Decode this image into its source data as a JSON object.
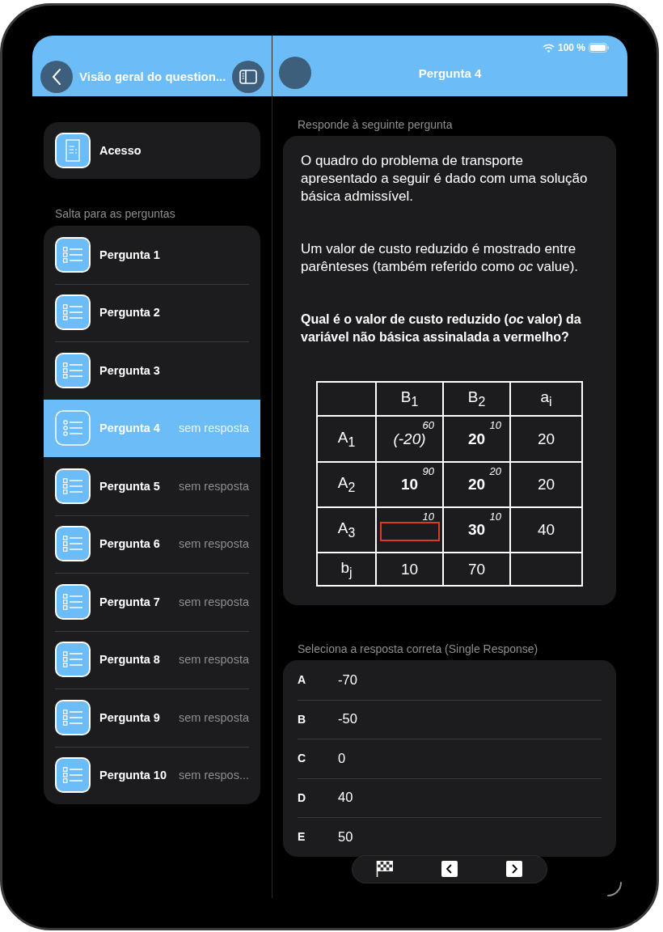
{
  "sidebar": {
    "title": "Visão geral do question...",
    "access_item": {
      "label": "Acesso"
    },
    "section_label": "Salta para as perguntas",
    "items": [
      {
        "label": "Pergunta 1",
        "selected": false
      },
      {
        "label": "Pergunta 2",
        "selected": false
      },
      {
        "label": "Pergunta 3",
        "selected": false
      },
      {
        "label": "Pergunta 4",
        "status": "sem resposta",
        "selected": true
      },
      {
        "label": "Pergunta 5",
        "status": "sem resposta",
        "selected": false
      },
      {
        "label": "Pergunta 6",
        "status": "sem resposta",
        "selected": false
      },
      {
        "label": "Pergunta 7",
        "status": "sem resposta",
        "selected": false
      },
      {
        "label": "Pergunta 8",
        "status": "sem resposta",
        "selected": false
      },
      {
        "label": "Pergunta 9",
        "status": "sem resposta",
        "selected": false
      },
      {
        "label": "Pergunta 10",
        "status": "sem respos...",
        "selected": false
      }
    ]
  },
  "status_bar": {
    "battery": "100 %"
  },
  "detail": {
    "title": "Pergunta 4",
    "question_label": "Responde à seguinte pergunta",
    "paragraphs": [
      {
        "text": "O quadro do problema de transporte apresentado a seguir é dado com uma solução básica admissível.",
        "bold": false
      },
      {
        "text": "Um valor de custo reduzido é mostrado entre parênteses (também referido como *oc* value).",
        "bold": false
      },
      {
        "text": "Qual é o valor de custo reduzido (*oc* valor) da variável não básica assinalada a vermelho?",
        "bold": true
      }
    ],
    "table": {
      "rows": [
        [
          {
            "kind": "empty"
          },
          {
            "kind": "label",
            "value": "B$_{1}$"
          },
          {
            "kind": "label",
            "value": "B$_{2}$"
          },
          {
            "kind": "label",
            "value": "a$_{i}$"
          }
        ],
        [
          {
            "kind": "label",
            "value": "A$_{1}$"
          },
          {
            "kind": "nonbasic",
            "value": "(-20)",
            "cost": "60"
          },
          {
            "kind": "basic",
            "value": "20",
            "cost": "10"
          },
          {
            "kind": "plain",
            "value": "20"
          }
        ],
        [
          {
            "kind": "label",
            "value": "A$_{2}$"
          },
          {
            "kind": "basic",
            "value": "10",
            "cost": "90"
          },
          {
            "kind": "basic",
            "value": "20",
            "cost": "20"
          },
          {
            "kind": "plain",
            "value": "20"
          }
        ],
        [
          {
            "kind": "label",
            "value": "A$_{3}$"
          },
          {
            "kind": "marked",
            "cost": "10"
          },
          {
            "kind": "basic",
            "value": "30",
            "cost": "10"
          },
          {
            "kind": "plain",
            "value": "40"
          }
        ],
        [
          {
            "kind": "label",
            "value": "b$_{j}$"
          },
          {
            "kind": "plain",
            "value": "10"
          },
          {
            "kind": "plain",
            "value": "70"
          },
          {
            "kind": "empty"
          }
        ]
      ]
    },
    "answers_label": "Seleciona a resposta correta (Single Response)",
    "answers": [
      {
        "letter": "A",
        "text": "-70"
      },
      {
        "letter": "B",
        "text": "-50"
      },
      {
        "letter": "C",
        "text": "0"
      },
      {
        "letter": "D",
        "text": "40"
      },
      {
        "letter": "E",
        "text": "50"
      }
    ]
  }
}
